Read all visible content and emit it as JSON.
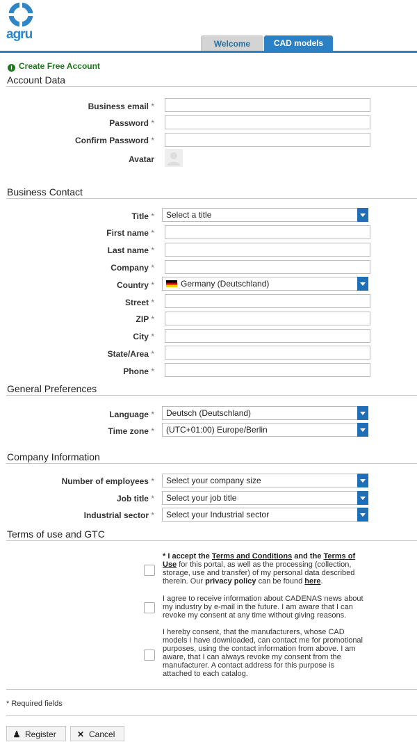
{
  "header": {
    "logo_text": "agru",
    "tabs": [
      {
        "label": "Welcome",
        "active": false
      },
      {
        "label": "CAD models",
        "active": true
      }
    ],
    "accent_color": "#2b81c5"
  },
  "page_title": "Create Free Account",
  "sections": {
    "account": "Account Data",
    "business": "Business Contact",
    "prefs": "General Preferences",
    "company": "Company Information",
    "terms": "Terms of use and GTC"
  },
  "account": {
    "business_email": "Business email",
    "password": "Password",
    "confirm_password": "Confirm Password",
    "avatar": "Avatar"
  },
  "business": {
    "title": "Title",
    "title_value": "Select a title",
    "first_name": "First name",
    "last_name": "Last name",
    "company": "Company",
    "country": "Country",
    "country_value": "Germany (Deutschland)",
    "street": "Street",
    "zip": "ZIP",
    "city": "City",
    "state": "State/Area",
    "phone": "Phone"
  },
  "prefs": {
    "language": "Language",
    "language_value": "Deutsch (Deutschland)",
    "timezone": "Time zone",
    "timezone_value": "(UTC+01:00) Europe/Berlin"
  },
  "company": {
    "employees": "Number of employees",
    "employees_value": "Select your company size",
    "job_title": "Job title",
    "job_title_value": "Select your job title",
    "sector": "Industrial sector",
    "sector_value": "Select your Industrial sector"
  },
  "terms": {
    "t1_star": "* ",
    "t1_a": "I accept the ",
    "t1_terms": "Terms and Conditions",
    "t1_and": " and the ",
    "t1_use": "Terms of Use",
    "t1_b": " for this portal, as well as the processing (collection, storage, use and transfer) of my personal data described therein. Our ",
    "t1_privacy": "privacy policy",
    "t1_c": " can be found ",
    "t1_here": "here",
    "t1_end": ".",
    "t2": "I agree to receive information about CADENAS news about my industry by e-mail in the future. I am aware that I can revoke my consent at any time without giving reasons.",
    "t3": "I hereby consent, that the manufacturers, whose CAD models I have downloaded, can contact me for promotional purposes, using the contact information from above. I am aware, that I can always revoke my consent from the manufacturer. A contact address for this purpose is attached to each catalog."
  },
  "required_star": "*",
  "required_note": "* Required fields",
  "buttons": {
    "register": "Register",
    "cancel": "Cancel"
  }
}
